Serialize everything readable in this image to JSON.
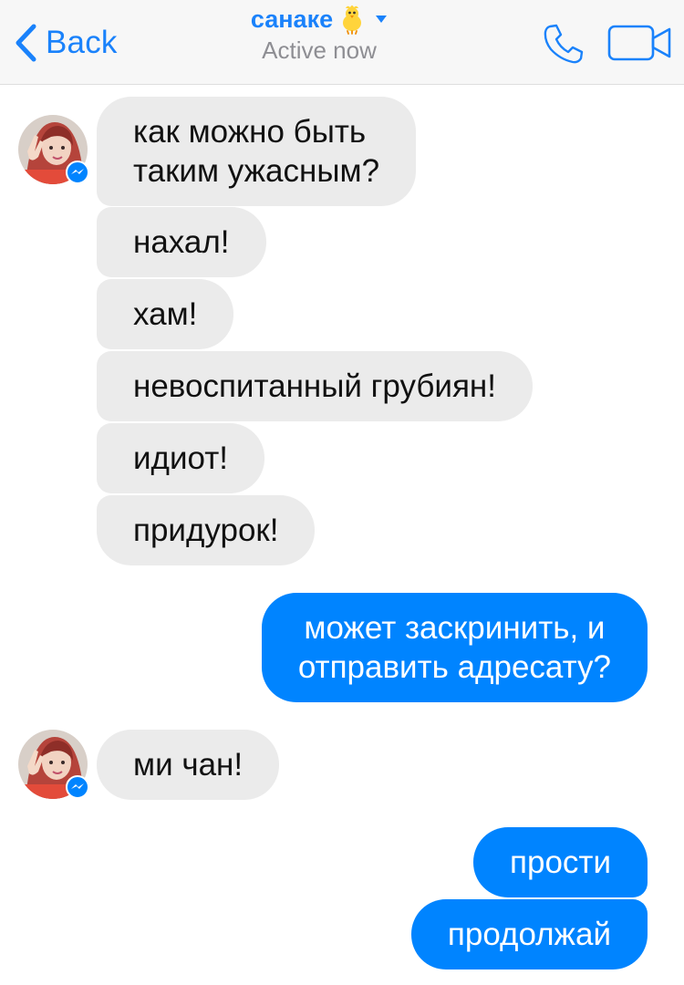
{
  "header": {
    "back_label": "Back",
    "contact_name": "санаке",
    "status": "Active now",
    "icons": {
      "back": "chevron-left-icon",
      "emoji": "baby-chick-emoji",
      "dropdown": "caret-down-icon",
      "call": "phone-icon",
      "video": "video-camera-icon"
    }
  },
  "messages": [
    {
      "from": "contact",
      "text": "как можно быть\nтаким ужасным?"
    },
    {
      "from": "contact",
      "text": "нахал!"
    },
    {
      "from": "contact",
      "text": "хам!"
    },
    {
      "from": "contact",
      "text": "невоспитанный грубиян!"
    },
    {
      "from": "contact",
      "text": "идиот!"
    },
    {
      "from": "contact",
      "text": "придурок!"
    },
    {
      "from": "me",
      "text": "может заскринить, и\nотправить адресату?"
    },
    {
      "from": "contact",
      "text": "ми чан!"
    },
    {
      "from": "me",
      "text": "прости"
    },
    {
      "from": "me",
      "text": "продолжай"
    }
  ],
  "colors": {
    "accent": "#1a82fb",
    "outgoing_bubble": "#0084ff",
    "incoming_bubble": "#ebebeb",
    "header_bg": "#f7f7f7",
    "status_gray": "#8e8e93"
  }
}
